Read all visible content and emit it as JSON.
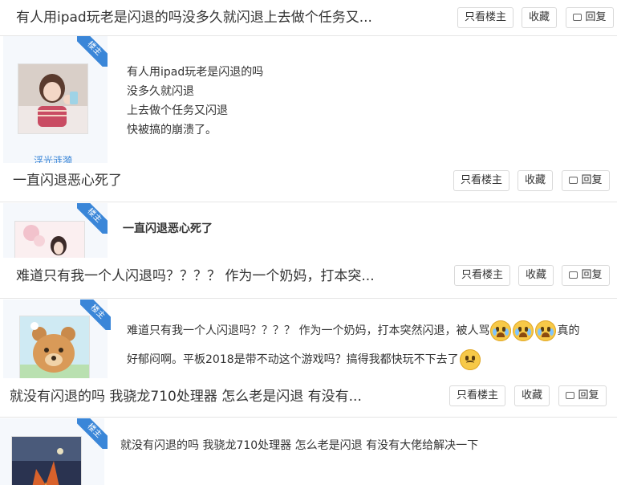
{
  "buttons": {
    "only_op": "只看楼主",
    "favorite": "收藏",
    "reply": "回复"
  },
  "badge": "楼主",
  "posts": [
    {
      "title": "有人用ipad玩老是闪退的吗没多久就闪退上去做个任务又...",
      "username": "浮光涟漪",
      "lines": [
        "有人用ipad玩老是闪退的吗",
        "没多久就闪退",
        "上去做个任务又闪退",
        "快被搞的崩溃了。"
      ]
    },
    {
      "title": "一直闪退恶心死了",
      "lines": [
        "一直闪退恶心死了"
      ]
    },
    {
      "title": "难道只有我一个人闪退吗？？？？ 作为一个奶妈，打本突...",
      "line1_a": "难道只有我一个人闪退吗？？？？ 作为一个奶妈，打本突然闪退，被人骂",
      "line1_b": "真的",
      "line2": "好郁闷啊。平板2018是带不动这个游戏吗？搞得我都快玩不下去了"
    },
    {
      "title": "就没有闪退的吗 我骁龙710处理器 怎么老是闪退 有没有...",
      "lines": [
        "就没有闪退的吗 我骁龙710处理器 怎么老是闪退 有没有大佬给解决一下"
      ]
    }
  ],
  "icons": {
    "reply": "comment-icon",
    "cry": "crying-face-icon",
    "frown": "frowning-face-icon"
  },
  "colors": {
    "accent": "#3a86d8",
    "border": "#e5e5e5",
    "avatar_bg": "#f5f8fc"
  }
}
